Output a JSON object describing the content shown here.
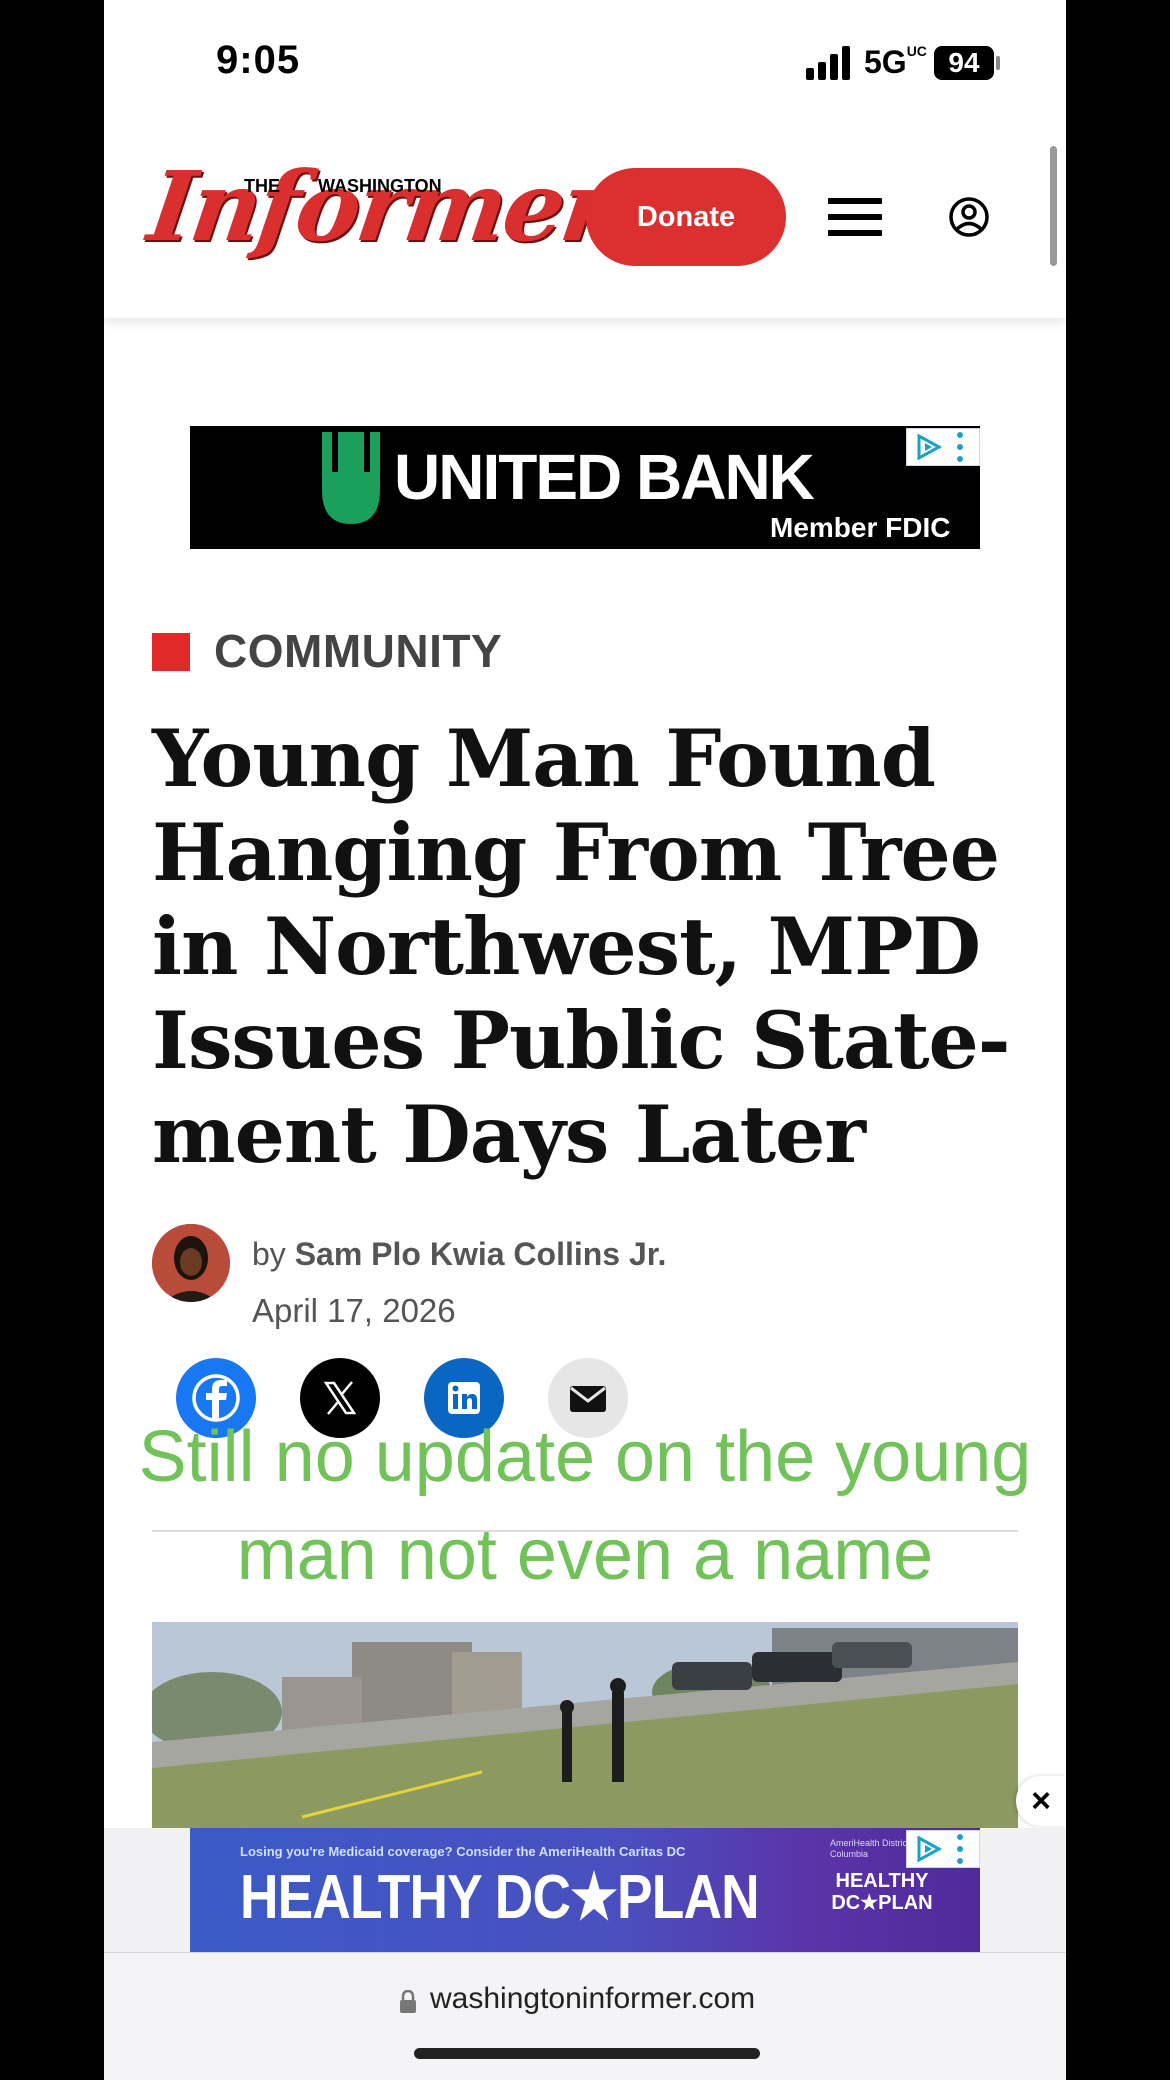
{
  "status_bar": {
    "time": "9:05",
    "network": "5G",
    "network_sup": "UC",
    "battery": "94"
  },
  "header": {
    "logo_the": "THE",
    "logo_washington": "WASHINGTON",
    "logo_main": "Informer",
    "donate_label": "Donate"
  },
  "ad_top": {
    "brand": "UNITED BANK",
    "sub": "Member FDIC"
  },
  "article": {
    "category": "COMMUNITY",
    "headline": "Young Man Found Hanging From Tree in Northwest, MPD Issues Public State-ment Days Later",
    "byline_prefix": "by",
    "author": "Sam Plo Kwia Collins Jr.",
    "date": "April 17, 2026"
  },
  "share": [
    "facebook-icon",
    "x-icon",
    "linkedin-icon",
    "email-icon"
  ],
  "overlay_text": "Still no update on the young man not even a name",
  "ad_bottom": {
    "tagline": "Losing you're Medicaid coverage? Consider the AmeriHealth Caritas DC",
    "main": "HEALTHY DC★PLAN",
    "small": "AmeriHealth District of Columbia",
    "side": "HEALTHY DC★PLAN"
  },
  "close_label": "×",
  "browser": {
    "url": "washingtoninformer.com"
  },
  "colors": {
    "brand_red": "#dc2f2f",
    "overlay_green": "#72c25a",
    "facebook": "#1877f2",
    "linkedin": "#0a66c2"
  }
}
